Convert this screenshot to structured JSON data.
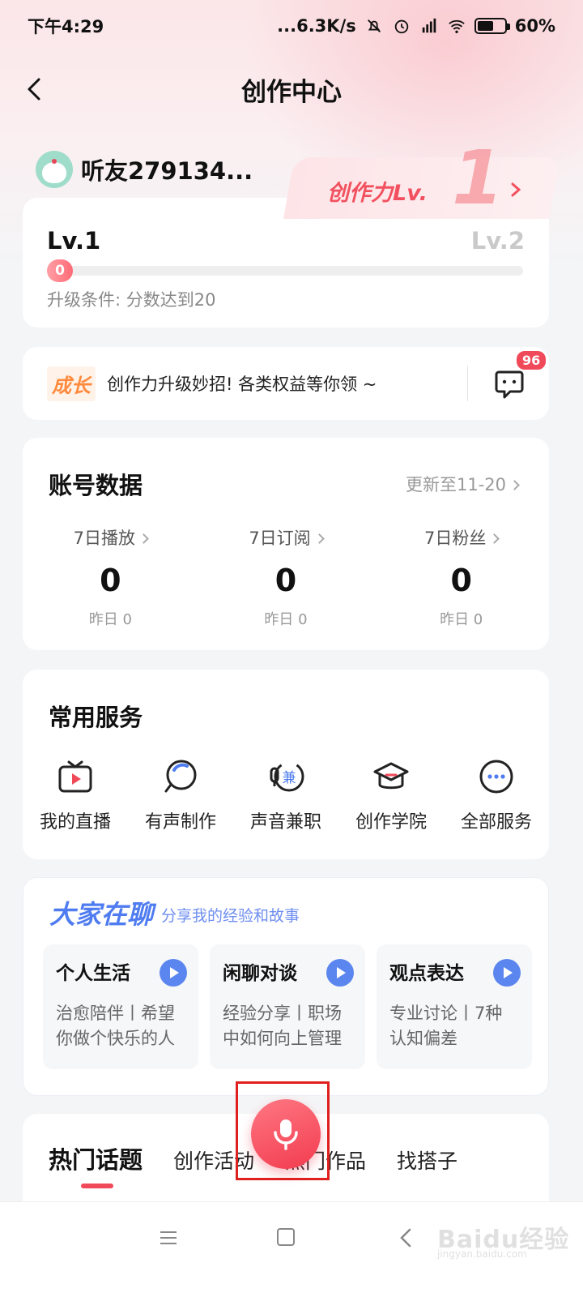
{
  "status": {
    "time": "下午4:29",
    "network": "...6.3K/s",
    "battery": "60%",
    "battery_level": 0.6
  },
  "nav": {
    "title": "创作中心"
  },
  "profile": {
    "username": "听友279134...",
    "level_label": "创作力Lv.",
    "level_number": "1",
    "current_level": "Lv.1",
    "next_level": "Lv.2",
    "progress_value": "0",
    "upgrade_condition": "升级条件: 分数达到20"
  },
  "growth": {
    "tag": "成长",
    "text": "创作力升级妙招! 各类权益等你领 ~",
    "message_count": "96"
  },
  "account_data": {
    "title": "账号数据",
    "updated": "更新至11-20",
    "stats": [
      {
        "label": "7日播放",
        "value": "0",
        "sub": "昨日 0"
      },
      {
        "label": "7日订阅",
        "value": "0",
        "sub": "昨日 0"
      },
      {
        "label": "7日粉丝",
        "value": "0",
        "sub": "昨日 0"
      }
    ]
  },
  "services": {
    "title": "常用服务",
    "items": [
      {
        "label": "我的直播",
        "icon": "tv-icon"
      },
      {
        "label": "有声制作",
        "icon": "search-record-icon"
      },
      {
        "label": "声音兼职",
        "icon": "part-time-icon"
      },
      {
        "label": "创作学院",
        "icon": "graduation-cap-icon"
      },
      {
        "label": "全部服务",
        "icon": "more-icon"
      }
    ],
    "badge_char": "兼"
  },
  "chat": {
    "title": "大家在聊",
    "subtitle": "分享我的经验和故事",
    "topics": [
      {
        "name": "个人生活",
        "desc": "治愈陪伴丨希望你做个快乐的人"
      },
      {
        "name": "闲聊对谈",
        "desc": "经验分享丨职场中如何向上管理"
      },
      {
        "name": "观点表达",
        "desc": "专业讨论丨7种认知偏差"
      }
    ]
  },
  "hot": {
    "tabs": [
      "热门话题",
      "创作活动",
      "热门作品",
      "找搭子"
    ]
  },
  "watermark": {
    "text": "Baidu经验",
    "sub": "jingyan.baidu.com"
  },
  "colors": {
    "accent": "#f04a5a",
    "blue": "#4f7cf0",
    "growth": "#ff8a3d"
  }
}
